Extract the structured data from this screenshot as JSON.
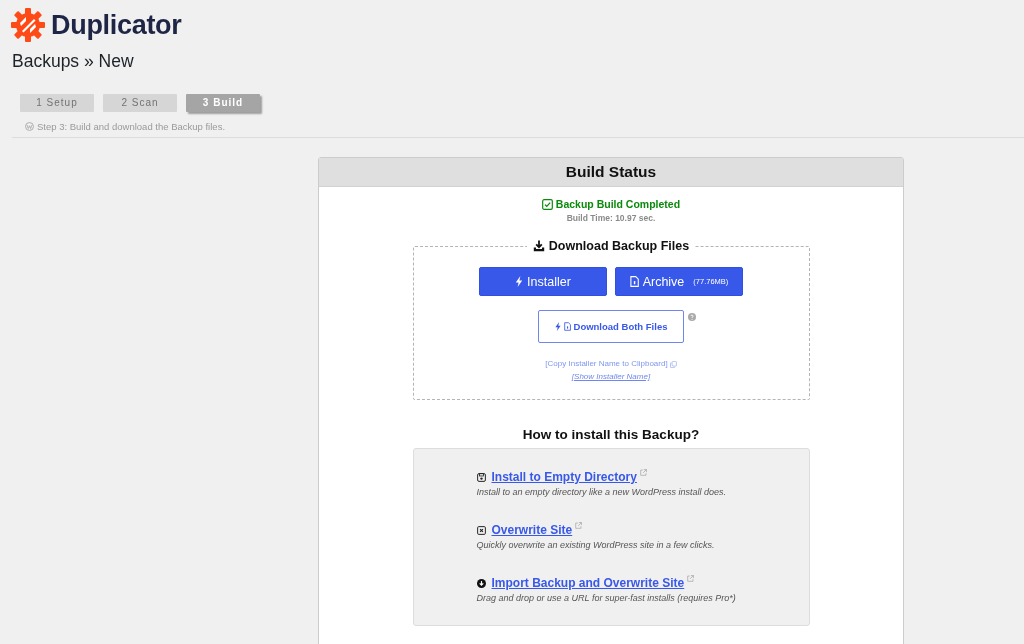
{
  "logo": {
    "name": "Duplicator"
  },
  "page_title": "Backups » New",
  "steps": [
    {
      "label": "1 Setup",
      "selected": false
    },
    {
      "label": "2 Scan",
      "selected": false
    },
    {
      "label": "3 Build",
      "selected": true
    }
  ],
  "step_caption": "Step 3: Build and download the Backup files.",
  "panel": {
    "title": "Build Status",
    "status": {
      "text": "Backup Build Completed",
      "detail": "Build Time: 10.97 sec."
    },
    "download": {
      "legend": "Download Backup Files",
      "buttons": [
        {
          "kind": "installer",
          "label": "Installer"
        },
        {
          "kind": "archive",
          "label": "Archive",
          "size": "(77.76MB)"
        }
      ],
      "both_button": "Download Both Files",
      "copy_link": "[Copy Installer Name to Clipboard]",
      "show_link": "[Show Installer Name]"
    },
    "install": {
      "title": "How to install this Backup?",
      "options": [
        {
          "kind": "empty-directory",
          "link": "Install to Empty Directory",
          "description": "Install to an empty directory like a new WordPress install does."
        },
        {
          "kind": "overwrite",
          "link": "Overwrite Site",
          "description": "Quickly overwrite an existing WordPress site in a few clicks."
        },
        {
          "kind": "import",
          "link": "Import Backup and Overwrite Site",
          "description": "Drag and drop or use a URL for super-fast installs (requires Pro*)"
        }
      ]
    }
  }
}
